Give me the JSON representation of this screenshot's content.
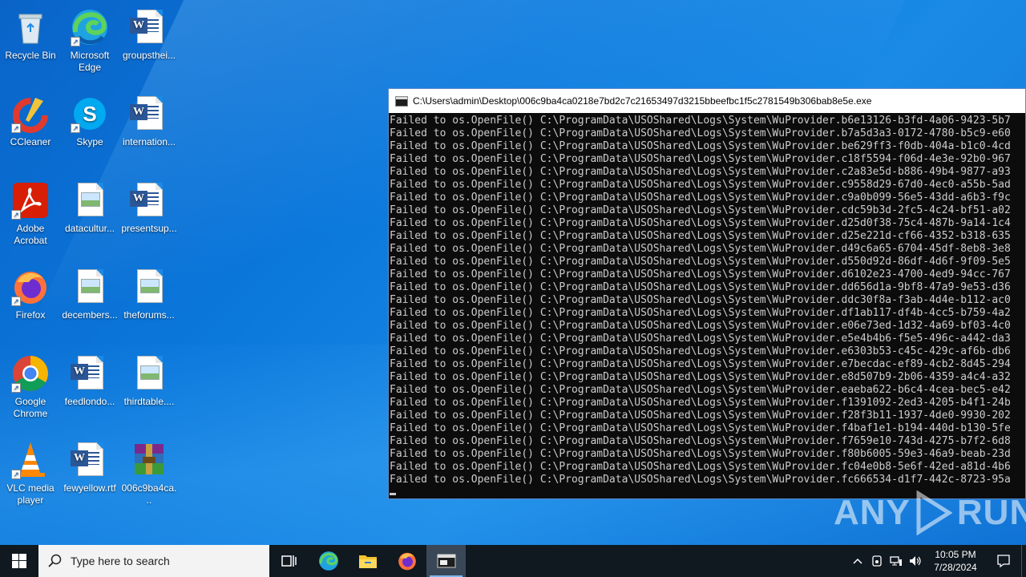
{
  "desktop": {
    "icons": [
      {
        "id": "recycle",
        "label": "Recycle Bin"
      },
      {
        "id": "edge",
        "label": "Microsoft Edge"
      },
      {
        "id": "groupsthei",
        "label": "groupsthei..."
      },
      {
        "id": "ccleaner",
        "label": "CCleaner"
      },
      {
        "id": "skype",
        "label": "Skype"
      },
      {
        "id": "internation",
        "label": "internation..."
      },
      {
        "id": "acrobat",
        "label": "Adobe Acrobat"
      },
      {
        "id": "datacultur",
        "label": "datacultur..."
      },
      {
        "id": "presentsup",
        "label": "presentsup..."
      },
      {
        "id": "firefox",
        "label": "Firefox"
      },
      {
        "id": "decembers",
        "label": "decembers..."
      },
      {
        "id": "theforums",
        "label": "theforums..."
      },
      {
        "id": "chrome",
        "label": "Google Chrome"
      },
      {
        "id": "feedlondo",
        "label": "feedlondo..."
      },
      {
        "id": "thirdtable",
        "label": "thirdtable...."
      },
      {
        "id": "vlc",
        "label": "VLC media player"
      },
      {
        "id": "fewyellow",
        "label": "fewyellow.rtf"
      },
      {
        "id": "archive",
        "label": "006c9ba4ca..."
      }
    ]
  },
  "console": {
    "title": "C:\\Users\\admin\\Desktop\\006c9ba4ca0218e7bd2c7c21653497d3215bbeefbc1f5c2781549b306bab8e5e.exe",
    "lines": [
      "Failed to os.OpenFile() C:\\ProgramData\\USOShared\\Logs\\System\\WuProvider.b6e13126-b3fd-4a06-9423-5b7",
      "Failed to os.OpenFile() C:\\ProgramData\\USOShared\\Logs\\System\\WuProvider.b7a5d3a3-0172-4780-b5c9-e60",
      "Failed to os.OpenFile() C:\\ProgramData\\USOShared\\Logs\\System\\WuProvider.be629ff3-f0db-404a-b1c0-4cd",
      "Failed to os.OpenFile() C:\\ProgramData\\USOShared\\Logs\\System\\WuProvider.c18f5594-f06d-4e3e-92b0-967",
      "Failed to os.OpenFile() C:\\ProgramData\\USOShared\\Logs\\System\\WuProvider.c2a83e5d-b886-49b4-9877-a93",
      "Failed to os.OpenFile() C:\\ProgramData\\USOShared\\Logs\\System\\WuProvider.c9558d29-67d0-4ec0-a55b-5ad",
      "Failed to os.OpenFile() C:\\ProgramData\\USOShared\\Logs\\System\\WuProvider.c9a0b099-56e5-43dd-a6b3-f9c",
      "Failed to os.OpenFile() C:\\ProgramData\\USOShared\\Logs\\System\\WuProvider.cdc59b3d-2fc5-4c24-bf51-a02",
      "Failed to os.OpenFile() C:\\ProgramData\\USOShared\\Logs\\System\\WuProvider.d25d0f38-75c4-487b-9a14-1c4",
      "Failed to os.OpenFile() C:\\ProgramData\\USOShared\\Logs\\System\\WuProvider.d25e221d-cf66-4352-b318-635",
      "Failed to os.OpenFile() C:\\ProgramData\\USOShared\\Logs\\System\\WuProvider.d49c6a65-6704-45df-8eb8-3e8",
      "Failed to os.OpenFile() C:\\ProgramData\\USOShared\\Logs\\System\\WuProvider.d550d92d-86df-4d6f-9f09-5e5",
      "Failed to os.OpenFile() C:\\ProgramData\\USOShared\\Logs\\System\\WuProvider.d6102e23-4700-4ed9-94cc-767",
      "Failed to os.OpenFile() C:\\ProgramData\\USOShared\\Logs\\System\\WuProvider.dd656d1a-9bf8-47a9-9e53-d36",
      "Failed to os.OpenFile() C:\\ProgramData\\USOShared\\Logs\\System\\WuProvider.ddc30f8a-f3ab-4d4e-b112-ac0",
      "Failed to os.OpenFile() C:\\ProgramData\\USOShared\\Logs\\System\\WuProvider.df1ab117-df4b-4cc5-b759-4a2",
      "Failed to os.OpenFile() C:\\ProgramData\\USOShared\\Logs\\System\\WuProvider.e06e73ed-1d32-4a69-bf03-4c0",
      "Failed to os.OpenFile() C:\\ProgramData\\USOShared\\Logs\\System\\WuProvider.e5e4b4b6-f5e5-496c-a442-da3",
      "Failed to os.OpenFile() C:\\ProgramData\\USOShared\\Logs\\System\\WuProvider.e6303b53-c45c-429c-af6b-db6",
      "Failed to os.OpenFile() C:\\ProgramData\\USOShared\\Logs\\System\\WuProvider.e7becdac-ef89-4cb2-8d45-294",
      "Failed to os.OpenFile() C:\\ProgramData\\USOShared\\Logs\\System\\WuProvider.e8d507b9-2b06-4359-a4c4-a32",
      "Failed to os.OpenFile() C:\\ProgramData\\USOShared\\Logs\\System\\WuProvider.eaeba622-b6c4-4cea-bec5-e42",
      "Failed to os.OpenFile() C:\\ProgramData\\USOShared\\Logs\\System\\WuProvider.f1391092-2ed3-4205-b4f1-24b",
      "Failed to os.OpenFile() C:\\ProgramData\\USOShared\\Logs\\System\\WuProvider.f28f3b11-1937-4de0-9930-202",
      "Failed to os.OpenFile() C:\\ProgramData\\USOShared\\Logs\\System\\WuProvider.f4baf1e1-b194-440d-b130-5fe",
      "Failed to os.OpenFile() C:\\ProgramData\\USOShared\\Logs\\System\\WuProvider.f7659e10-743d-4275-b7f2-6d8",
      "Failed to os.OpenFile() C:\\ProgramData\\USOShared\\Logs\\System\\WuProvider.f80b6005-59e3-46a9-beab-23d",
      "Failed to os.OpenFile() C:\\ProgramData\\USOShared\\Logs\\System\\WuProvider.fc04e0b8-5e6f-42ed-a81d-4b6",
      "Failed to os.OpenFile() C:\\ProgramData\\USOShared\\Logs\\System\\WuProvider.fc666534-d1f7-442c-8723-95a"
    ]
  },
  "watermark": {
    "left": "ANY",
    "right": "RUN"
  },
  "taskbar": {
    "search_placeholder": "Type here to search",
    "clock_time": "10:05 PM",
    "clock_date": "7/28/2024"
  },
  "colors": {
    "desktop_bg": "#0b78dc",
    "taskbar_bg": "#101820",
    "console_bg": "#0c0c0c",
    "console_text": "#cccccc"
  }
}
